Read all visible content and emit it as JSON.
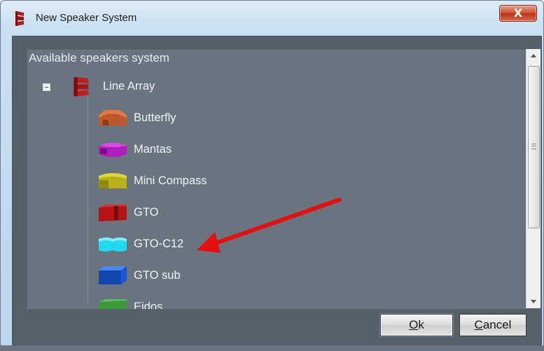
{
  "window": {
    "title": "New Speaker System",
    "close_glyph": "X"
  },
  "panel": {
    "label": "Available speakers system"
  },
  "tree": {
    "root": {
      "label": "Line Array",
      "icon": "line-array-speaker-icon",
      "color": "#b31b1b",
      "expanded": true
    },
    "children": [
      {
        "label": "Butterfly",
        "icon": "speaker-butterfly-icon",
        "color": "#c0562a"
      },
      {
        "label": "Mantas",
        "icon": "speaker-mantas-icon",
        "color": "#b01ebd"
      },
      {
        "label": "Mini Compass",
        "icon": "speaker-mini-compass-icon",
        "color": "#b7b21a"
      },
      {
        "label": "GTO",
        "icon": "speaker-gto-icon",
        "color": "#b41414"
      },
      {
        "label": "GTO-C12",
        "icon": "speaker-gto-c12-icon",
        "color": "#22d8f0"
      },
      {
        "label": "GTO sub",
        "icon": "speaker-gto-sub-icon",
        "color": "#1858d8"
      },
      {
        "label": "Eidos",
        "icon": "speaker-eidos-icon",
        "color": "#3a9a3a"
      }
    ]
  },
  "buttons": {
    "ok_mnemonic": "O",
    "ok_rest": "k",
    "cancel_mnemonic": "C",
    "cancel_rest": "ancel"
  },
  "annotation": {
    "arrow_color": "#e60f0f",
    "points_to": "GTO-C12"
  }
}
